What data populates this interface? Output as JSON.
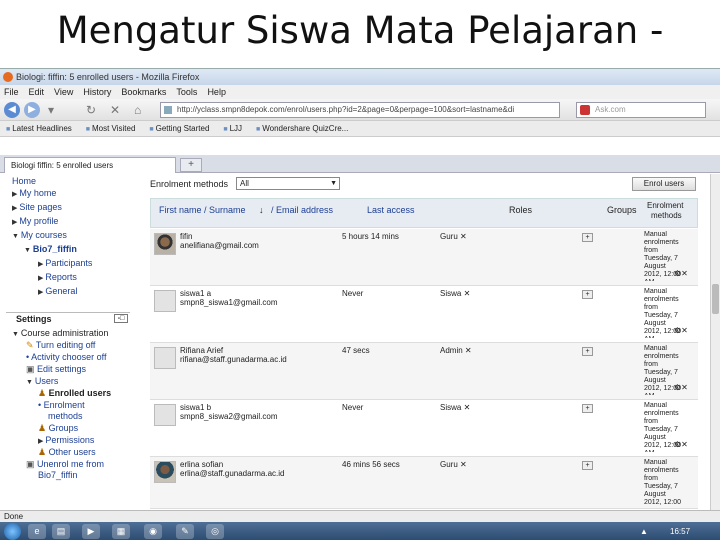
{
  "slide_title": "Mengatur Siswa Mata Pelajaran -",
  "window": {
    "title": "Biologi: fiffin: 5 enrolled users - Mozilla Firefox",
    "menu": [
      "File",
      "Edit",
      "View",
      "History",
      "Bookmarks",
      "Tools",
      "Help"
    ],
    "url": "http://yclass.smpn8depok.com/enrol/users.php?id=2&page=0&perpage=100&sort=lastname&di",
    "search_placeholder": "Ask.com",
    "bookmarks": [
      "Latest Headlines",
      "Most Visited",
      "Getting Started",
      "LJJ",
      "Wondershare QuizCre..."
    ],
    "tab_label": "Biologi fiffin: 5 enrolled users",
    "tab_add": "+",
    "status": "Done",
    "clock": "16:57",
    "tray": "▲"
  },
  "sidebar": {
    "home": "Home",
    "my_home": "My home",
    "site_pages": "Site pages",
    "my_profile": "My profile",
    "my_courses": "My courses",
    "course": "Bio7_fiffin",
    "participants": "Participants",
    "reports": "Reports",
    "general": "General",
    "settings_title": "Settings",
    "course_admin": "Course administration",
    "turn_editing": "Turn editing off",
    "activity_chooser": "Activity chooser off",
    "edit_settings": "Edit settings",
    "users": "Users",
    "enrolled_users": "Enrolled users",
    "enrolment_methods_1": "Enrolment",
    "enrolment_methods_2": "methods",
    "groups": "Groups",
    "permissions": "Permissions",
    "other_users": "Other users",
    "unenrol_1": "Unenrol me from",
    "unenrol_2": "Bio7_fiffin"
  },
  "main": {
    "enrolment_label": "Enrolment methods",
    "enrolment_value": "All",
    "enrol_button": "Enrol users",
    "headers": {
      "name": "First name / Surname",
      "sort_arrow": "↓",
      "email": "/ Email address",
      "last_access": "Last access",
      "roles": "Roles",
      "groups": "Groups",
      "enrolment_1": "Enrolment",
      "enrolment_2": "methods"
    },
    "users": [
      {
        "name": "fifin",
        "email": "anelifiana@gmail.com",
        "last": "5 hours 14 mins",
        "role": "Guru ✕",
        "enrol": "Manual\nenrolments\nfrom\nTuesday, 7\nAugust\n2012, 12:00\nAM"
      },
      {
        "name": "siswa1 a",
        "email": "smpn8_siswa1@gmail.com",
        "last": "Never",
        "role": "Siswa ✕",
        "enrol": "Manual\nenrolments\nfrom\nTuesday, 7\nAugust\n2012, 12:00\nAM"
      },
      {
        "name": "Rifiana Arief",
        "email": "rifiana@staff.gunadarma.ac.id",
        "last": "47 secs",
        "role": "Admin ✕",
        "enrol": "Manual\nenrolments\nfrom\nTuesday, 7\nAugust\n2012, 12:00\nAM"
      },
      {
        "name": "siswa1 b",
        "email": "smpn8_siswa2@gmail.com",
        "last": "Never",
        "role": "Siswa ✕",
        "enrol": "Manual\nenrolments\nfrom\nTuesday, 7\nAugust\n2012, 12:00\nAM"
      },
      {
        "name": "erlina sofian",
        "email": "erlina@staff.gunadarma.ac.id",
        "last": "46 mins 56 secs",
        "role": "Guru ✕",
        "enrol": "Manual\nenrolments\nfrom\nTuesday, 7\nAugust\n2012, 12:00"
      }
    ],
    "row_icons": "⚙✕"
  },
  "colors": {
    "link": "#1c3f94",
    "header_bg": "#e7ecf3",
    "taskbar": "#2c4a6f"
  }
}
